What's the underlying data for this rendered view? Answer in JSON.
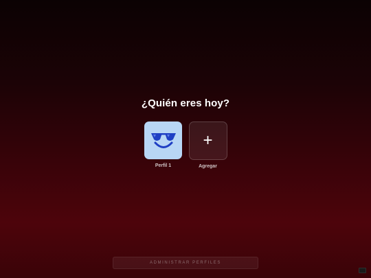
{
  "page": {
    "title": "¿Quién eres hoy?"
  },
  "profiles": [
    {
      "name": "Perfil 1",
      "avatar_icon": "sunglasses-face-icon",
      "tile_color": "#b8d6f5"
    },
    {
      "name": "Agregar",
      "avatar_icon": "plus-icon",
      "tile_color": "#2a0f12"
    }
  ],
  "actions": {
    "manage_label": "ADMINISTRAR PERFILES"
  },
  "colors": {
    "background_top": "#0b0203",
    "background_bottom": "#4d040b",
    "avatar_glasses": "#1f3fc4",
    "avatar_smile": "#1f3fc4"
  }
}
